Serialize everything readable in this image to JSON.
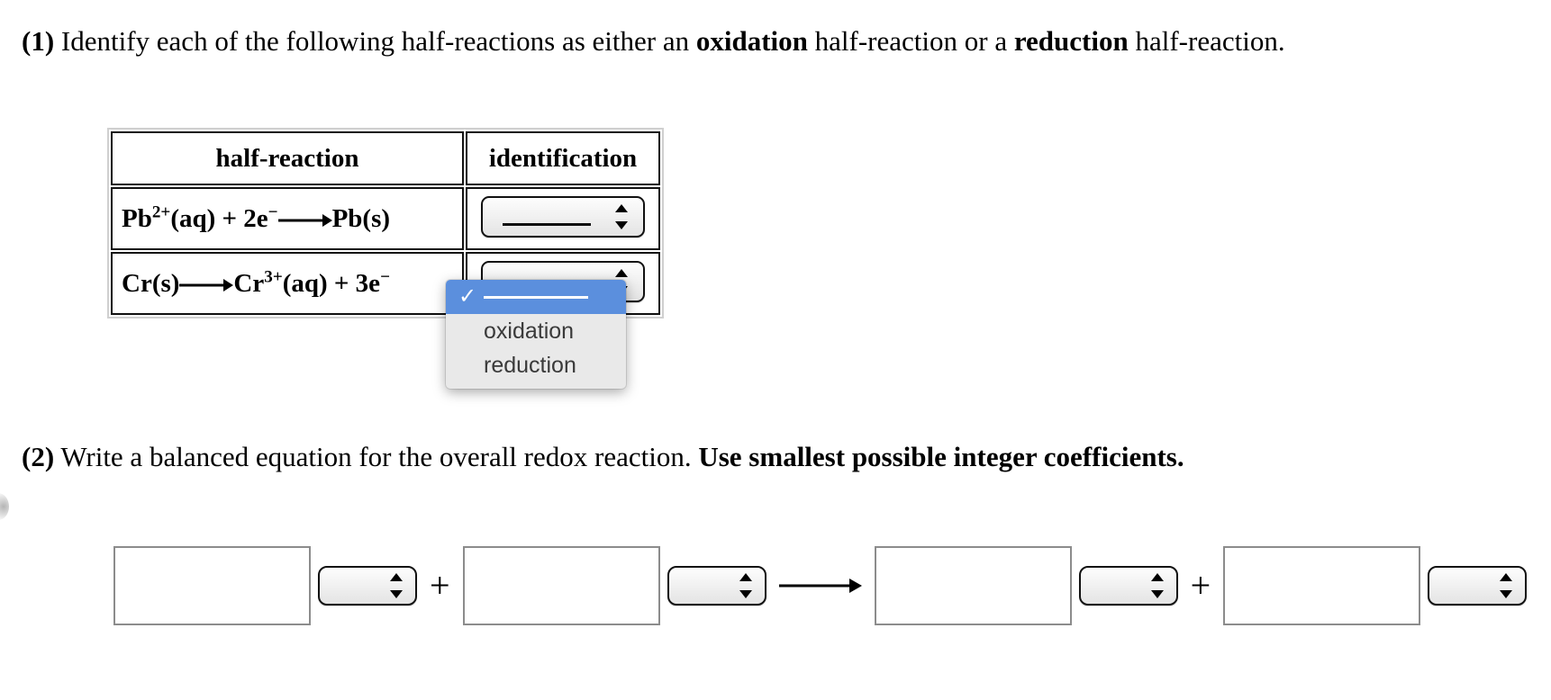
{
  "questions": {
    "q1": {
      "number": "(1)",
      "text_a": "Identify each of the following half-reactions as either an ",
      "bold_a": "oxidation",
      "text_b": " half-reaction or a ",
      "bold_b": "reduction",
      "text_c": " half-reaction."
    },
    "q2": {
      "number": "(2)",
      "text_a": "Write a balanced equation for the overall redox reaction. ",
      "bold_a": "Use smallest possible integer coefficients."
    }
  },
  "table": {
    "headers": {
      "half_reaction": "half-reaction",
      "identification": "identification"
    },
    "rows": [
      {
        "reaction_species_1": "Pb",
        "reaction_charge_1": "2+",
        "reaction_mid_1": "(aq) + 2e",
        "reaction_charge_2": "−",
        "reaction_tail": "Pb(s)",
        "select_value": ""
      },
      {
        "reaction_species_1": "Cr(s)",
        "reaction_tail_species": "Cr",
        "reaction_charge_1": "3+",
        "reaction_mid_1": "(aq) + 3e",
        "reaction_charge_2": "−",
        "select_value": ""
      }
    ]
  },
  "dropdown": {
    "open": true,
    "highlight_color": "#5b8fdd",
    "background_color": "#e9e9e9",
    "check_glyph": "✓",
    "items": [
      {
        "label": "",
        "is_blank": true,
        "selected": true
      },
      {
        "label": "oxidation",
        "is_blank": false,
        "selected": false
      },
      {
        "label": "reduction",
        "is_blank": false,
        "selected": false
      }
    ]
  },
  "equation": {
    "plus_1": "+",
    "plus_2": "+",
    "arrow": "⟶",
    "terms": [
      {
        "coefficient": "",
        "formula": ""
      },
      {
        "coefficient": "",
        "formula": ""
      },
      {
        "coefficient": "",
        "formula": ""
      },
      {
        "coefficient": "",
        "formula": ""
      }
    ]
  },
  "select_widget": {
    "up_arrow": "▲",
    "down_arrow": "▼"
  }
}
